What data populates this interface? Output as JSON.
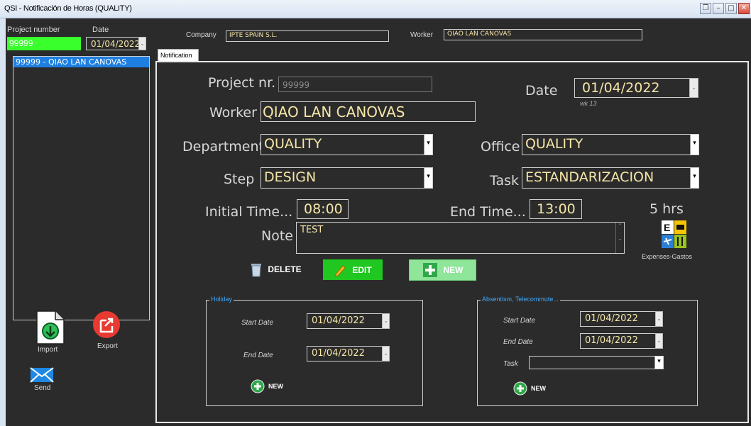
{
  "window": {
    "title": "QSI - Notificación de Horas (QUALITY)",
    "buttons": [
      "❐",
      "–",
      "□",
      "✕"
    ]
  },
  "sidebar": {
    "project_number_label": "Project number",
    "date_label": "Date",
    "project_number_value": "99999",
    "date_value": "01/04/2022",
    "list_items": [
      "99999 - QIAO LAN CANOVAS"
    ],
    "import_label": "Import",
    "export_label": "Export",
    "send_label": "Send"
  },
  "header": {
    "company_label": "Company",
    "company_value": "IPTE SPAIN S.L.",
    "worker_label": "Worker",
    "worker_value": "QIAO LAN CANOVAS"
  },
  "tabs": [
    {
      "label": "Notification"
    }
  ],
  "form": {
    "project_nr_label": "Project nr.",
    "project_nr_value": "99999",
    "date_label": "Date",
    "date_value": "01/04/2022",
    "week": "wk  13",
    "worker_label": "Worker",
    "worker_value": "QIAO LAN CANOVAS",
    "department_label": "Department",
    "department_value": "QUALITY",
    "office_label": "Office",
    "office_value": "QUALITY",
    "step_label": "Step",
    "step_value": "DESIGN",
    "task_label": "Task",
    "task_value": "ESTANDARIZACION",
    "initial_time_label": "Initial Time...",
    "initial_time_value": "08:00",
    "end_time_label": "End Time...",
    "end_time_value": "13:00",
    "hours": "5  hrs",
    "note_label": "Note",
    "note_value": "TEST",
    "expenses_label": "Expenses-Gastos",
    "delete_label": "DELETE",
    "edit_label": "EDIT",
    "new_label": "NEW"
  },
  "holiday": {
    "legend": "Holiday",
    "start_label": "Start Date",
    "start_value": "01/04/2022",
    "end_label": "End Date",
    "end_value": "01/04/2022",
    "new_label": "NEW"
  },
  "absentism": {
    "legend": "Absentism, Telecommute...",
    "start_label": "Start Date",
    "start_value": "01/04/2022",
    "end_label": "End Date",
    "end_value": "01/04/2022",
    "task_label": "Task",
    "task_value": "",
    "new_label": "NEW"
  },
  "colors": {
    "background": "#2b2b2b",
    "value_text": "#f5e6a8",
    "accent_green": "#39ff2c",
    "legend_blue": "#3fa9ff",
    "selection": "#1e7fe0"
  }
}
